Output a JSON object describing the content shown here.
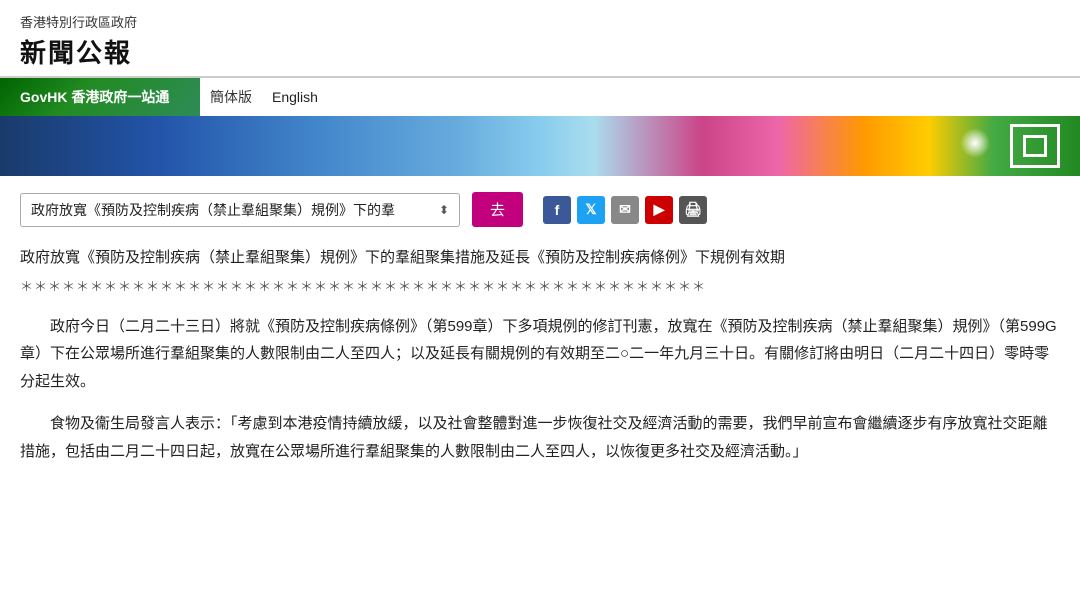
{
  "header": {
    "subtitle": "香港特別行政區政府",
    "title": "新聞公報"
  },
  "navbar": {
    "govhk_label": "GovHK 香港政府一站通",
    "simplified_label": "簡体版",
    "english_label": "English"
  },
  "toolbar": {
    "dropdown_value": "政府放寬《預防及控制疾病（禁止羣組聚集）規例》下的羣",
    "go_button_label": "去",
    "social": {
      "fb": "f",
      "tw": "t",
      "mail": "✉",
      "yt": "▶",
      "print": "🖨"
    }
  },
  "article": {
    "title": "政府放寬《預防及控制疾病（禁止羣組聚集）規例》下的羣組聚集措施及延長《預防及控制疾病條例》下規例有效期",
    "stars": "＊＊＊＊＊＊＊＊＊＊＊＊＊＊＊＊＊＊＊＊＊＊＊＊＊＊＊＊＊＊＊＊＊＊＊＊＊＊＊＊＊＊＊＊＊＊＊＊＊",
    "para1": "政府今日（二月二十三日）將就《預防及控制疾病條例》（第599章）下多項規例的修訂刊憲，放寬在《預防及控制疾病（禁止羣組聚集）規例》（第599G章）下在公眾場所進行羣組聚集的人數限制由二人至四人；以及延長有關規例的有效期至二○二一年九月三十日。有關修訂將由明日（二月二十四日）零時零分起生效。",
    "para2": "食物及衞生局發言人表示：「考慮到本港疫情持續放緩，以及社會整體對進一步恢復社交及經濟活動的需要，我們早前宣布會繼續逐步有序放寬社交距離措施，包括由二月二十四日起，放寬在公眾場所進行羣組聚集的人數限制由二人至四人，以恢復更多社交及經濟活動。」"
  }
}
